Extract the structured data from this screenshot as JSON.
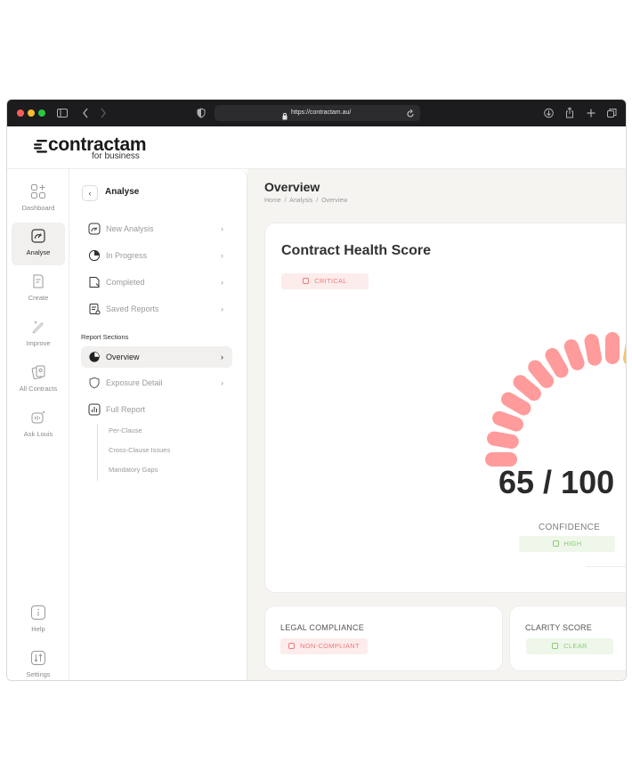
{
  "browser": {
    "url": "https://contractam.au/"
  },
  "brand": {
    "name": "contractam",
    "tagline": "for business"
  },
  "rail": {
    "items": [
      {
        "label": "Dashboard",
        "icon": "grid-plus-icon"
      },
      {
        "label": "Analyse",
        "icon": "gauge-icon",
        "active": true
      },
      {
        "label": "Create",
        "icon": "document-edit-icon"
      },
      {
        "label": "Improve",
        "icon": "magic-wand-icon"
      },
      {
        "label": "All Contracts",
        "icon": "documents-icon"
      },
      {
        "label": "Ask Louis",
        "icon": "voice-sparkle-icon"
      }
    ],
    "bottom": [
      {
        "label": "Help",
        "icon": "info-icon"
      },
      {
        "label": "Settings",
        "icon": "sliders-icon"
      }
    ]
  },
  "nav": {
    "back": "‹",
    "title": "Analyse",
    "items": [
      {
        "label": "New Analysis",
        "chevron": "›"
      },
      {
        "label": "In Progress",
        "chevron": "›"
      },
      {
        "label": "Completed",
        "chevron": "›"
      },
      {
        "label": "Saved Reports",
        "chevron": "›"
      }
    ],
    "section_heading": "Report Sections",
    "sections": [
      {
        "label": "Overview",
        "chevron": "›",
        "active": true
      },
      {
        "label": "Exposure Detail",
        "chevron": "›"
      },
      {
        "label": "Full Report"
      }
    ],
    "subitems": [
      "Per-Clause",
      "Cross-Clause Issues",
      "Mandatory Gaps"
    ]
  },
  "page": {
    "title": "Overview",
    "breadcrumb": [
      "Home",
      "/",
      "Analysis",
      "/",
      "Overview"
    ]
  },
  "health": {
    "title": "Contract Health Score",
    "status": "CRITICAL",
    "score": "65 / 100",
    "score_value": 65,
    "score_max": 100,
    "confidence_label": "CONFIDENCE",
    "confidence": "HIGH"
  },
  "cards": {
    "legal": {
      "title": "LEGAL COMPLIANCE",
      "status": "NON-COMPLIANT"
    },
    "clarity": {
      "title": "CLARITY SCORE",
      "status": "CLEAR"
    }
  },
  "colors": {
    "critical": "#ff9b9b",
    "warning": "#f6c567",
    "good": "#a9d690",
    "background": "#f5f4f1"
  }
}
